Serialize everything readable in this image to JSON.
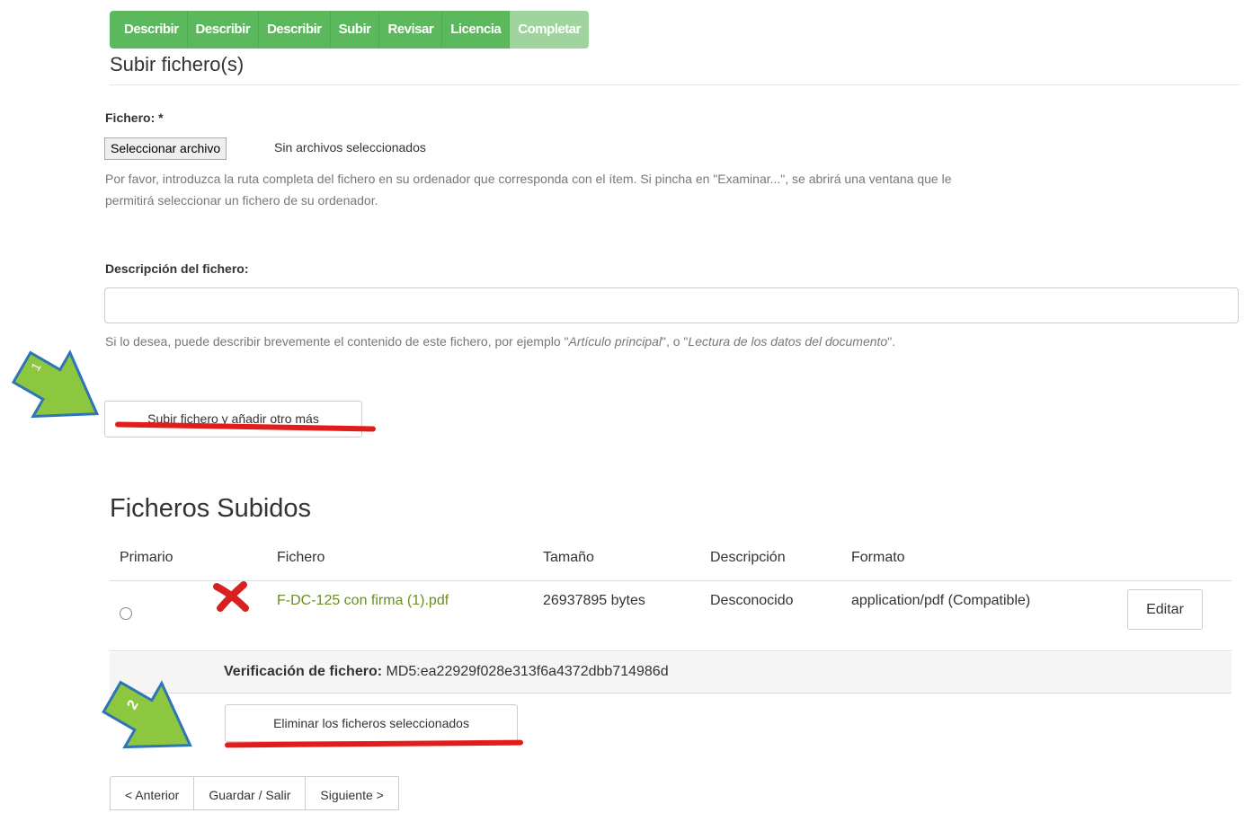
{
  "steps": [
    "Describir",
    "Describir",
    "Describir",
    "Subir",
    "Revisar",
    "Licencia",
    "Completar"
  ],
  "colors": {
    "step_active": "#5cb85c",
    "step_inactive": "#9fd49f",
    "annotation_arrow": "#8dc63f",
    "annotation_underline": "#e21b1b",
    "delete_mark": "#d92020",
    "file_link": "#6b8e23"
  },
  "upload": {
    "title": "Subir fichero(s)",
    "file_label": "Fichero: *",
    "choose_button": "Seleccionar archivo",
    "no_file": "Sin archivos seleccionados",
    "help_line1": "Por favor, introduzca la ruta completa del fichero en su ordenador que corresponda con el ítem. Si pincha en \"Examinar...\", se abrirá una ventana que le",
    "help_line2": "permitirá seleccionar un fichero de su ordenador.",
    "description_label": "Descripción del fichero:",
    "description_value": "",
    "description_help_a": "Si lo desea, puede describir brevemente el contenido de este fichero, por ejemplo \"",
    "description_help_em1": "Artículo principal",
    "description_help_b": "\", o \"",
    "description_help_em2": "Lectura de los datos del documento",
    "description_help_c": "\".",
    "upload_more_button": "Subir fichero y añadir otro más"
  },
  "uploaded": {
    "title": "Ficheros Subidos",
    "columns": [
      "Primario",
      "Fichero",
      "Tamaño",
      "Descripción",
      "Formato"
    ],
    "rows": [
      {
        "primary": false,
        "file": "F-DC-125 con firma (1).pdf",
        "size": "26937895 bytes",
        "description": "Desconocido",
        "format": "application/pdf (Compatible)",
        "edit_button": "Editar"
      }
    ],
    "checksum_label": "Verificación de fichero:",
    "checksum_value": "MD5:ea22929f028e313f6a4372dbb714986d",
    "delete_button": "Eliminar los ficheros seleccionados"
  },
  "nav": {
    "prev": "< Anterior",
    "save": "Guardar / Salir",
    "next": "Siguiente >"
  },
  "annotations": {
    "arrow1_label": "1",
    "arrow2_label": "2",
    "arrow_icon": "green-arrow-icon",
    "delete_icon": "red-x-icon"
  }
}
